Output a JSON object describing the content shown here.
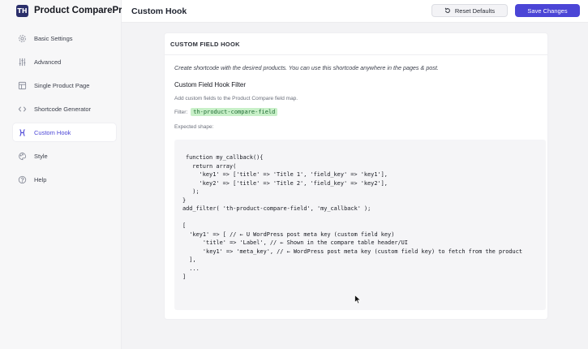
{
  "brand": {
    "name": "Product ComparePro",
    "logo_text": "TH"
  },
  "sidebar": {
    "items": [
      {
        "label": "Basic Settings",
        "icon": "gear-icon",
        "active": false
      },
      {
        "label": "Advanced",
        "icon": "sliders-icon",
        "active": false
      },
      {
        "label": "Single Product Page",
        "icon": "layout-icon",
        "active": false
      },
      {
        "label": "Shortcode Generator",
        "icon": "code-icon",
        "active": false
      },
      {
        "label": "Custom Hook",
        "icon": "hook-icon",
        "active": true
      },
      {
        "label": "Style",
        "icon": "palette-icon",
        "active": false
      },
      {
        "label": "Help",
        "icon": "help-icon",
        "active": false
      }
    ]
  },
  "header": {
    "title": "Custom Hook",
    "reset_label": "Reset Defaults",
    "save_label": "Save Changes"
  },
  "card": {
    "title": "CUSTOM FIELD HOOK",
    "intro": "Create shortcode with the desired products. You can use this shortcode anywhere in the pages & post.",
    "subtitle": "Custom Field Hook Filter",
    "description": "Add custom fields to the Product Compare field map.",
    "filter_label": "Filter:",
    "filter_name": "th-product-compare-field",
    "shape_label": "Expected shape:",
    "code_lines": [
      "function my_callback(){",
      "  return array(",
      "    'key1' => ['title' => 'Title 1', 'field_key' => 'key1'],",
      "    'key2' => ['title' => 'Title 2', 'field_key' => 'key2'],",
      "  );",
      "}",
      "add_filter( 'th-product-compare-field', 'my_callback' );",
      "",
      "[",
      "  'key1' => [ // ← U WordPress post meta key (custom field key)",
      "      'title' => 'Label', // ← Shown in the compare table header/UI",
      "      'key1' => 'meta_key', // ← WordPress post meta key (custom field key) to fetch from the product",
      "  ],",
      "  ...",
      "]"
    ]
  },
  "colors": {
    "accent": "#4b45d6",
    "filter_bg": "#c8f0c8",
    "filter_text": "#1f6b34"
  }
}
